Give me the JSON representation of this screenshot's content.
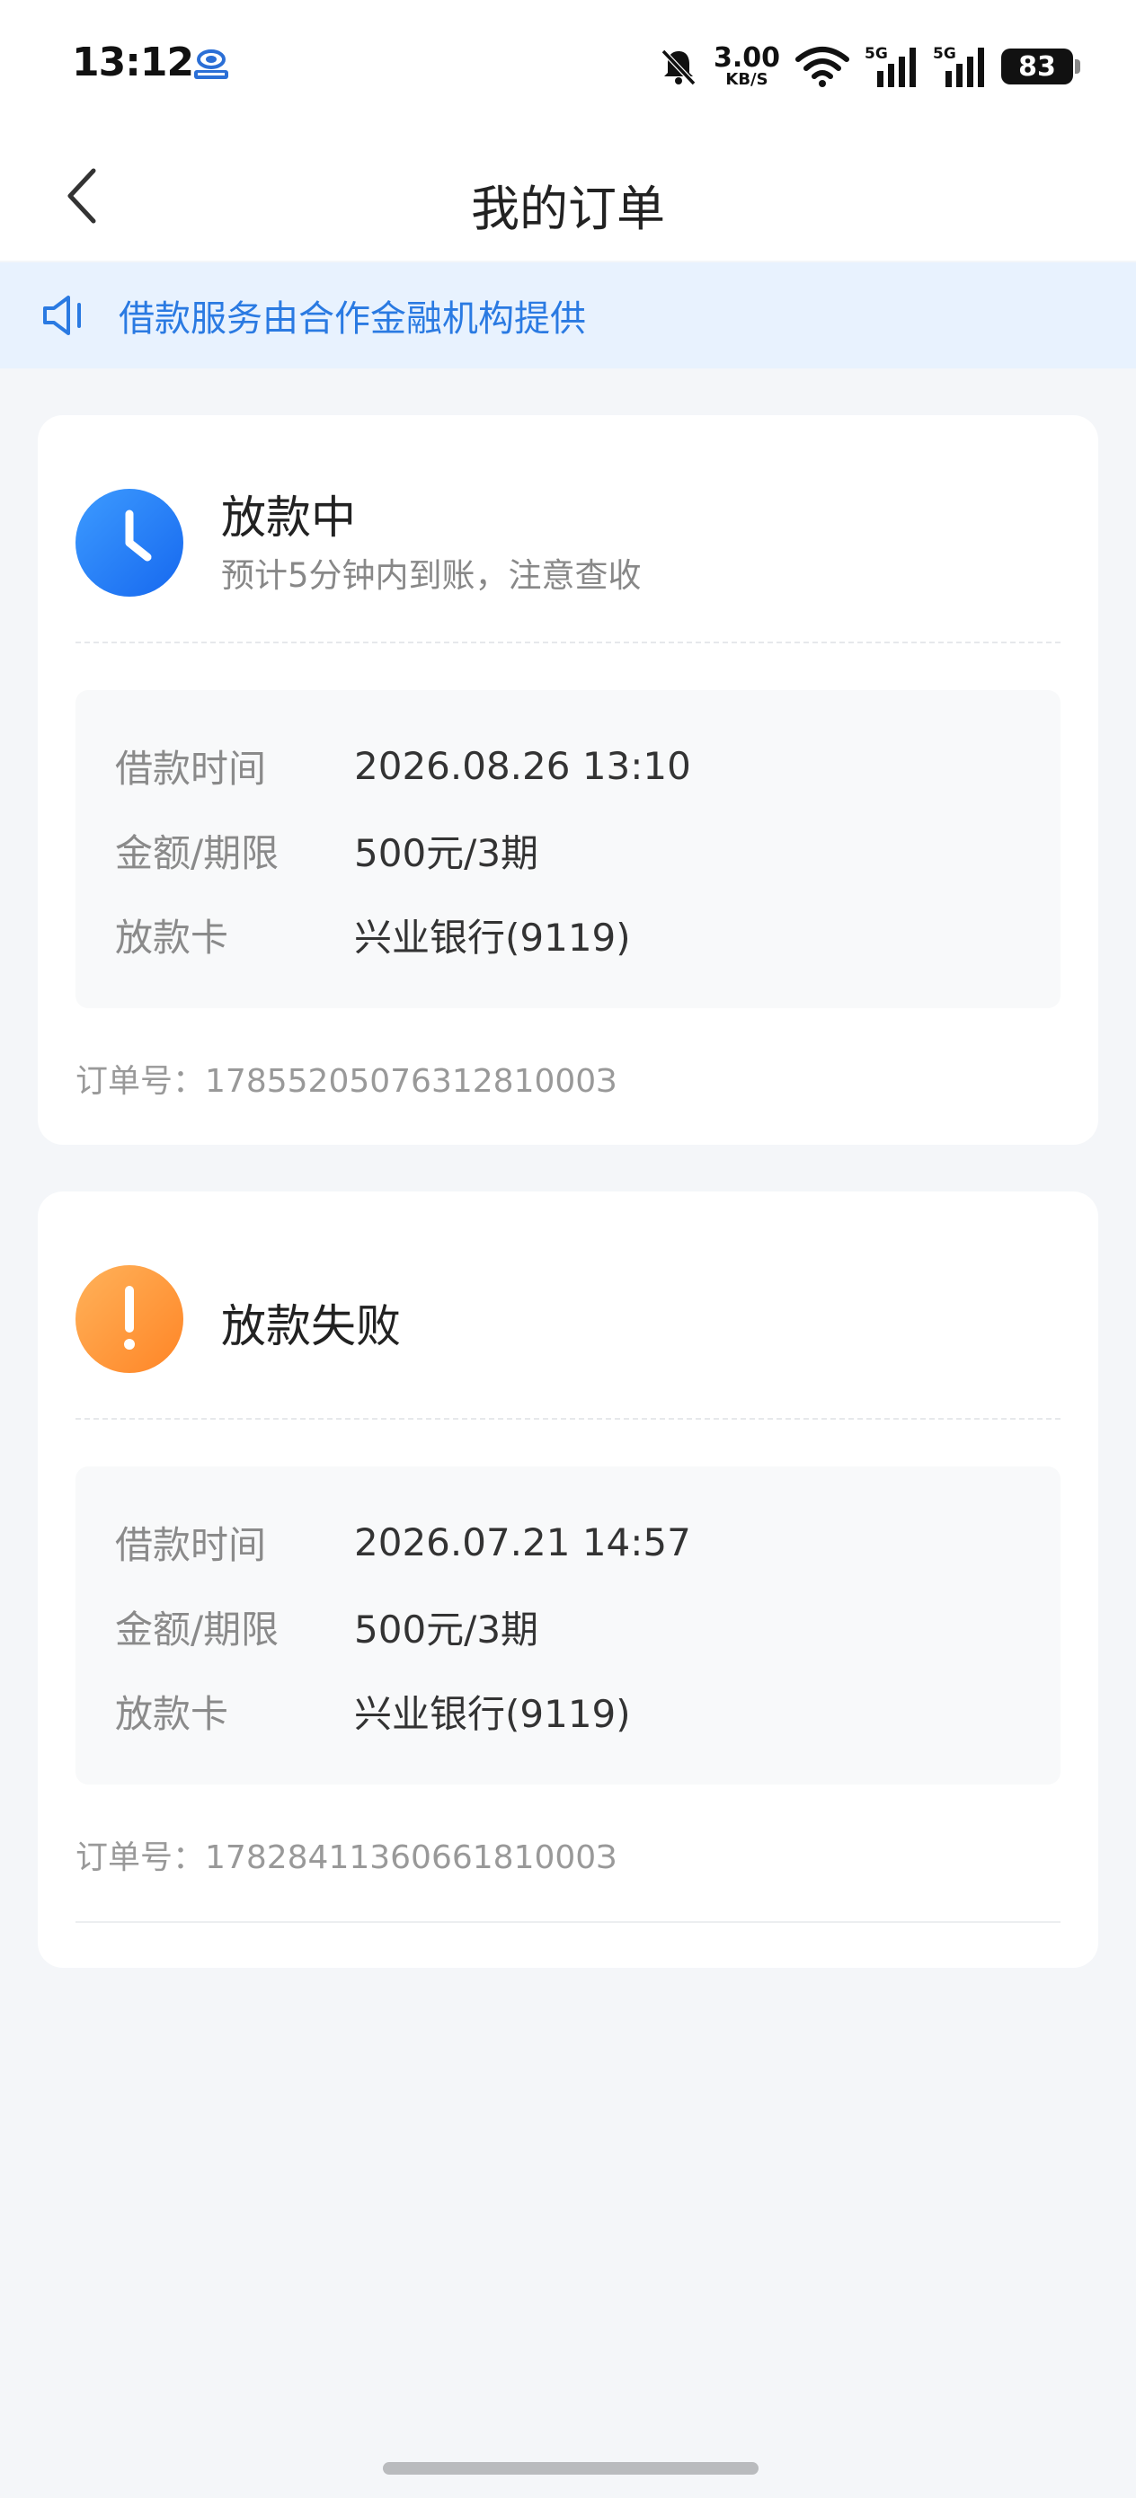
{
  "status_bar": {
    "time": "13:12",
    "net_speed_value": "3.00",
    "net_speed_unit": "KB/S",
    "signal1_label": "5G",
    "signal2_label": "5G",
    "battery": "83"
  },
  "header": {
    "title": "我的订单"
  },
  "notice": {
    "text": "借款服务由合作金融机构提供"
  },
  "orders": [
    {
      "status": "放款中",
      "status_sub": "预计5分钟内到账，注意查收",
      "status_icon": "clock-icon",
      "status_color": "#1a73f0",
      "rows": [
        {
          "label": "借款时间",
          "value": "2026.08.26 13:10"
        },
        {
          "label": "金额/期限",
          "value": "500元/3期"
        },
        {
          "label": "放款卡",
          "value": "兴业银行(9119)"
        }
      ],
      "order_no_label": "订单号：",
      "order_no": "1785520507631281000З"
    },
    {
      "status": "放款失败",
      "status_icon": "exclamation-icon",
      "status_color": "#ff8a2e",
      "rows": [
        {
          "label": "借款时间",
          "value": "2026.07.21 14:57"
        },
        {
          "label": "金额/期限",
          "value": "500元/3期"
        },
        {
          "label": "放款卡",
          "value": "兴业银行(9119)"
        }
      ],
      "order_no_label": "订单号：",
      "order_no": "1782841136066181000З"
    }
  ]
}
